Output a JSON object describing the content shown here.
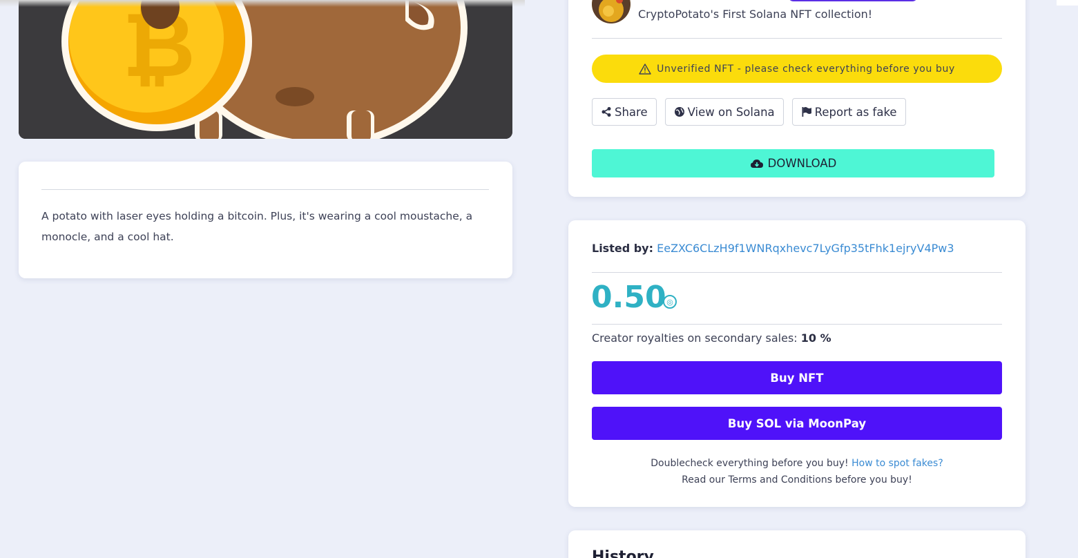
{
  "collection": {
    "description": "CryptoPotato's First Solana NFT collection!"
  },
  "warning": {
    "icon": "warning-icon",
    "text": "Unverified NFT - please check everything before you buy"
  },
  "actions": {
    "share": "Share",
    "view_on_solana": "View on Solana",
    "report": "Report as fake",
    "download": "DOWNLOAD"
  },
  "nft": {
    "description": "A potato with laser eyes holding a bitcoin. Plus, it's wearing a cool moustache, a monocle, and a cool hat."
  },
  "listing": {
    "listed_by_label": "Listed by:",
    "listed_by_address": "EeZXC6CLzH9f1WNRqxhevc7LyGfp35tFhk1ejryV4Pw3",
    "price": "0.50",
    "royalties_label": "Creator royalties on secondary sales:",
    "royalties_value": "10 %",
    "buy_nft": "Buy NFT",
    "buy_sol": "Buy SOL via MoonPay",
    "note_text": "Doublecheck everything before you buy!",
    "note_link": "How to spot fakes?",
    "terms_text": "Read our Terms and Conditions before you buy!"
  },
  "history": {
    "title": "History"
  },
  "colors": {
    "background": "#eceff9",
    "warning": "#fbdc0c",
    "download": "#4ef6d5",
    "primary": "#4f12f9",
    "price": "#2fb1c4",
    "link": "#3a8bd3"
  }
}
